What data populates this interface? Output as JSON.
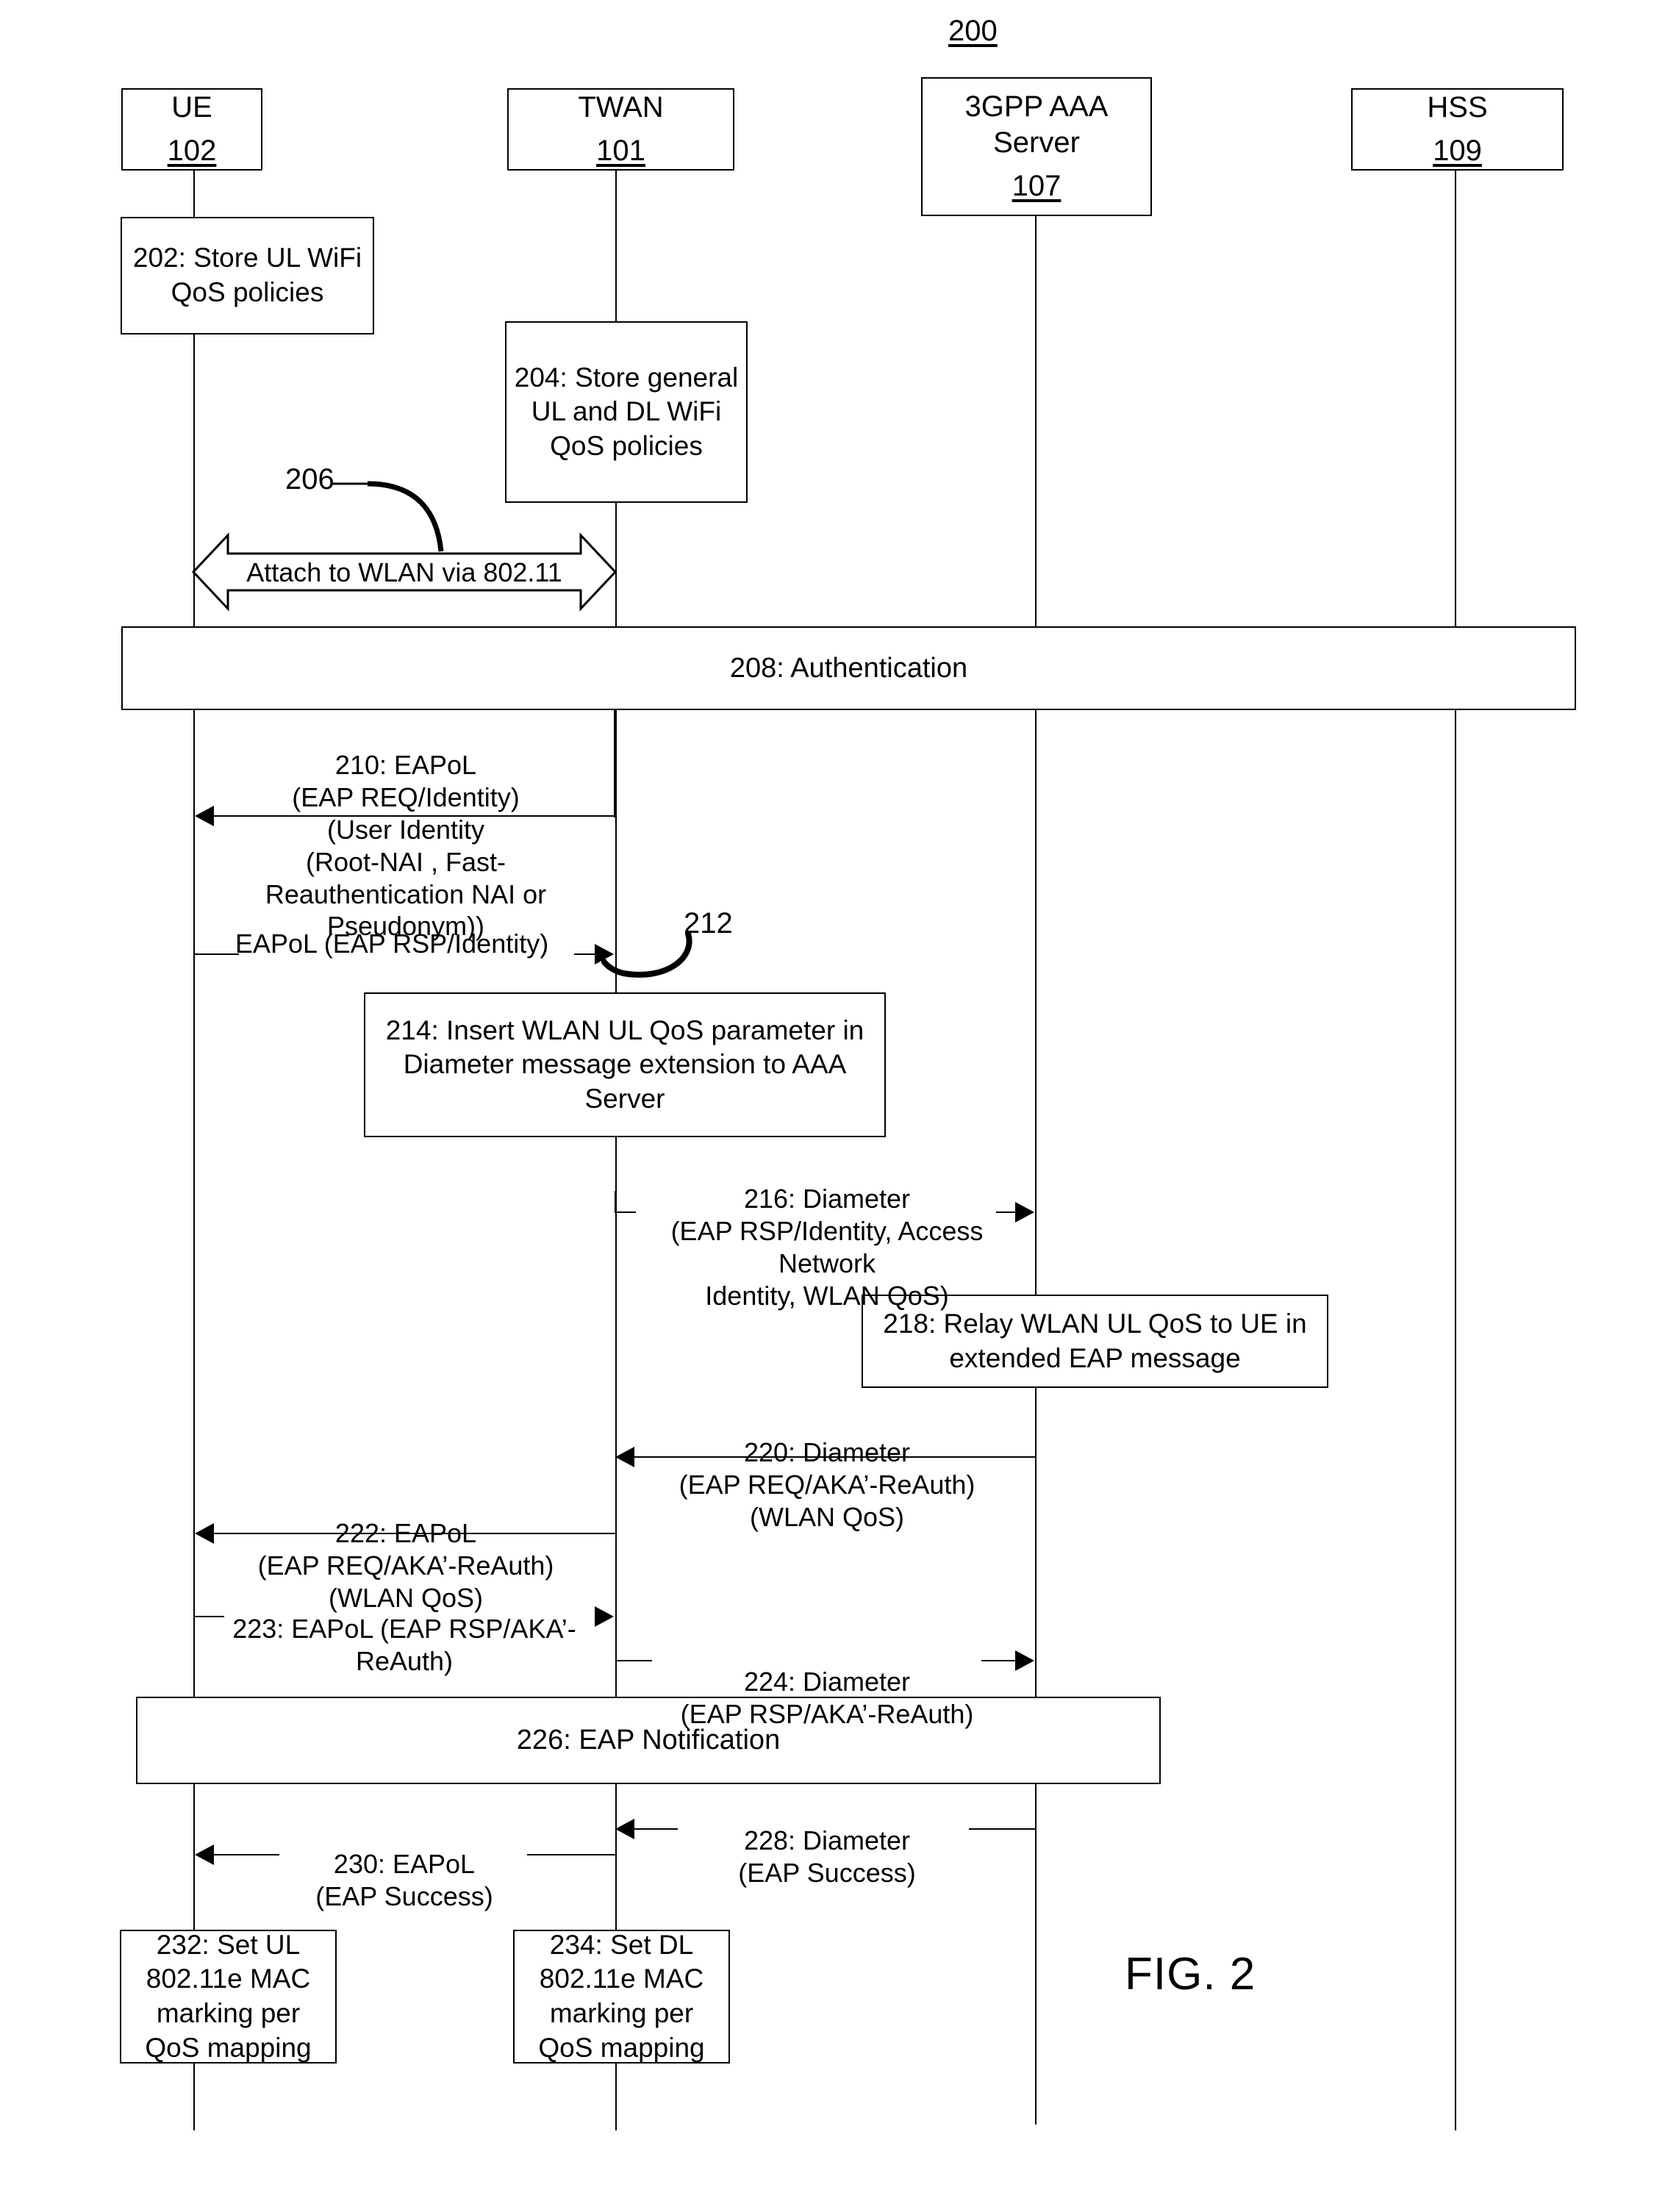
{
  "figure": {
    "number_label": "200",
    "caption": "FIG. 2"
  },
  "lifelines": [
    {
      "id": "ue",
      "name": "UE",
      "ref": "102"
    },
    {
      "id": "twan",
      "name": "TWAN",
      "ref": "101"
    },
    {
      "id": "aaa",
      "name": "3GPP AAA\nServer",
      "name_line1": "3GPP AAA",
      "name_line2": "Server",
      "ref": "107"
    },
    {
      "id": "hss",
      "name": "HSS",
      "ref": "109"
    }
  ],
  "steps": {
    "s202": {
      "num": "202",
      "text": "202: Store UL WiFi QoS policies",
      "kind": "process",
      "actor": "ue"
    },
    "s204": {
      "num": "204",
      "text": "204: Store general UL and DL WiFi QoS policies",
      "kind": "process",
      "actor": "twan"
    },
    "s206": {
      "num": "206",
      "text": "Attach to WLAN via 802.11",
      "kind": "banner",
      "from": "ue",
      "to": "twan"
    },
    "s208": {
      "num": "208",
      "text": "208: Authentication",
      "kind": "span",
      "from": "ue",
      "to": "hss"
    },
    "s210": {
      "num": "210",
      "text": "210: EAPoL\n(EAP REQ/Identity)\n(User Identity\n(Root-NAI , Fast-\nReauthentication NAI or\nPseudonym))",
      "kind": "message",
      "from": "twan",
      "to": "ue",
      "direction": "left"
    },
    "s211": {
      "num": "",
      "text": "EAPoL (EAP RSP/Identity)",
      "kind": "message",
      "from": "ue",
      "to": "twan",
      "direction": "right"
    },
    "s212": {
      "num": "212",
      "text": "212",
      "kind": "callout"
    },
    "s214": {
      "num": "214",
      "text": "214: Insert WLAN UL QoS parameter in Diameter message extension to AAA Server",
      "kind": "process",
      "actor": "twan"
    },
    "s216": {
      "num": "216",
      "text": "216: Diameter\n(EAP RSP/Identity, Access\nNetwork\nIdentity, WLAN QoS)",
      "kind": "message",
      "from": "twan",
      "to": "aaa",
      "direction": "right"
    },
    "s218": {
      "num": "218",
      "text": "218: Relay WLAN UL QoS to UE in extended EAP message",
      "kind": "process",
      "actor": "aaa"
    },
    "s220": {
      "num": "220",
      "text": "220: Diameter\n(EAP REQ/AKA’-ReAuth)\n(WLAN QoS)",
      "kind": "message",
      "from": "aaa",
      "to": "twan",
      "direction": "left"
    },
    "s222": {
      "num": "222",
      "text": "222: EAPoL\n(EAP REQ/AKA’-ReAuth)\n(WLAN QoS)",
      "kind": "message",
      "from": "twan",
      "to": "ue",
      "direction": "left"
    },
    "s223": {
      "num": "223",
      "text": "223: EAPoL (EAP RSP/AKA’-\nReAuth)",
      "kind": "message",
      "from": "ue",
      "to": "twan",
      "direction": "right"
    },
    "s224": {
      "num": "224",
      "text": "224: Diameter\n(EAP RSP/AKA’-ReAuth)",
      "kind": "message",
      "from": "twan",
      "to": "aaa",
      "direction": "right"
    },
    "s226": {
      "num": "226",
      "text": "226: EAP Notification",
      "kind": "span",
      "from": "ue",
      "to": "aaa"
    },
    "s228": {
      "num": "228",
      "text": "228: Diameter\n(EAP Success)",
      "kind": "message",
      "from": "aaa",
      "to": "twan",
      "direction": "left"
    },
    "s230": {
      "num": "230",
      "text": "230: EAPoL\n(EAP Success)",
      "kind": "message",
      "from": "twan",
      "to": "ue",
      "direction": "left"
    },
    "s232": {
      "num": "232",
      "text": "232: Set UL 802.11e MAC marking per QoS mapping",
      "kind": "process",
      "actor": "ue"
    },
    "s234": {
      "num": "234",
      "text": "234: Set DL 802.11e MAC marking per QoS mapping",
      "kind": "process",
      "actor": "twan"
    }
  },
  "colors": {
    "stroke": "#000000",
    "background": "#ffffff"
  }
}
